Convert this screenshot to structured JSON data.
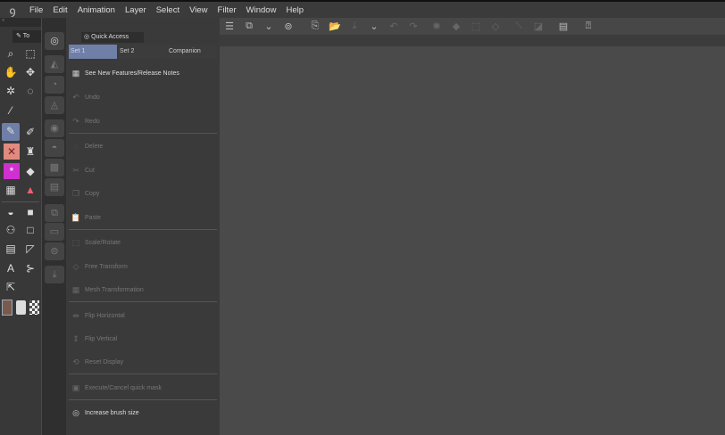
{
  "menu": {
    "items": [
      "File",
      "Edit",
      "Animation",
      "Layer",
      "Select",
      "View",
      "Filter",
      "Window",
      "Help"
    ]
  },
  "tool_panel": {
    "tab_label": "To"
  },
  "quick_access": {
    "title": "Quick Access",
    "tabs": [
      "Set 1",
      "Set 2",
      "Companion"
    ],
    "items": [
      {
        "label": "See New Features/Release Notes",
        "icon": "news-icon",
        "enabled": true
      },
      {
        "label": "Undo",
        "icon": "undo-icon",
        "enabled": false
      },
      {
        "label": "Redo",
        "icon": "redo-icon",
        "enabled": false
      },
      {
        "label": "Delete",
        "icon": "delete-icon",
        "enabled": false
      },
      {
        "label": "Cut",
        "icon": "scissors-icon",
        "enabled": false
      },
      {
        "label": "Copy",
        "icon": "copy-icon",
        "enabled": false
      },
      {
        "label": "Paste",
        "icon": "paste-icon",
        "enabled": false
      },
      {
        "label": "Scale/Rotate",
        "icon": "scale-icon",
        "enabled": false
      },
      {
        "label": "Free Transform",
        "icon": "transform-icon",
        "enabled": false
      },
      {
        "label": "Mesh Transformation",
        "icon": "mesh-icon",
        "enabled": false
      },
      {
        "label": "Flip Horizontal",
        "icon": "flip-horizontal-icon",
        "enabled": false
      },
      {
        "label": "Flip Vertical",
        "icon": "flip-vertical-icon",
        "enabled": false
      },
      {
        "label": "Reset Display",
        "icon": "reset-icon",
        "enabled": false
      },
      {
        "label": "Execute/Cancel quick mask",
        "icon": "mask-icon",
        "enabled": false
      },
      {
        "label": "Increase brush size",
        "icon": "brush-size-icon",
        "enabled": true
      }
    ]
  },
  "colors": {
    "accent": "#6f7fa8",
    "main_color": "#7a5a4c",
    "magenta": "#d030d0"
  }
}
